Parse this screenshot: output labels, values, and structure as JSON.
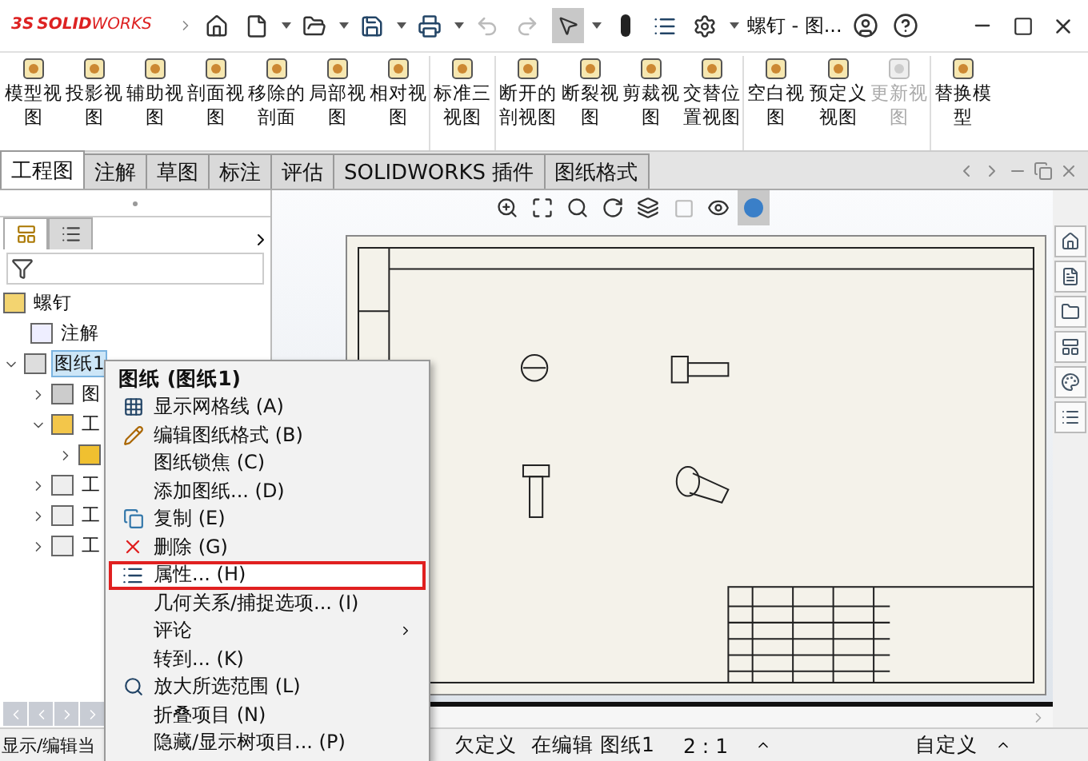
{
  "app": {
    "brand_prefix": "3S",
    "brand": "SOLID",
    "brand_suffix": "WORKS",
    "document_title": "螺钉 - 图..."
  },
  "ribbon": [
    {
      "label": "模型视图",
      "disabled": false,
      "separator_before": false
    },
    {
      "label": "投影视图",
      "disabled": false,
      "separator_before": false
    },
    {
      "label": "辅助视图",
      "disabled": false,
      "separator_before": false
    },
    {
      "label": "剖面视图",
      "disabled": false,
      "separator_before": false
    },
    {
      "label": "移除的剖面",
      "disabled": false,
      "separator_before": false
    },
    {
      "label": "局部视图",
      "disabled": false,
      "separator_before": false
    },
    {
      "label": "相对视图",
      "disabled": false,
      "separator_before": false
    },
    {
      "label": "标准三视图",
      "disabled": false,
      "separator_before": true
    },
    {
      "label": "断开的剖视图",
      "disabled": false,
      "separator_before": true
    },
    {
      "label": "断裂视图",
      "disabled": false,
      "separator_before": false
    },
    {
      "label": "剪裁视图",
      "disabled": false,
      "separator_before": false
    },
    {
      "label": "交替位置视图",
      "disabled": false,
      "separator_before": false
    },
    {
      "label": "空白视图",
      "disabled": false,
      "separator_before": true
    },
    {
      "label": "预定义视图",
      "disabled": false,
      "separator_before": false
    },
    {
      "label": "更新视图",
      "disabled": true,
      "separator_before": false
    },
    {
      "label": "替换模型",
      "disabled": false,
      "separator_before": true
    }
  ],
  "tabs": [
    {
      "label": "工程图",
      "selected": true
    },
    {
      "label": "注解",
      "selected": false
    },
    {
      "label": "草图",
      "selected": false
    },
    {
      "label": "标注",
      "selected": false
    },
    {
      "label": "评估",
      "selected": false
    },
    {
      "label": "SOLIDWORKS 插件",
      "selected": false
    },
    {
      "label": "图纸格式",
      "selected": false
    }
  ],
  "tree": {
    "label": "螺钉",
    "children": [
      {
        "label": "注解",
        "kind": "annotation",
        "selected": false
      },
      {
        "label": "图纸1",
        "kind": "sheet",
        "selected": true,
        "expanded": true,
        "children": [
          {
            "label": "图",
            "kind": "format",
            "selected": false,
            "expanded": false
          },
          {
            "label": "工",
            "kind": "view",
            "selected": false,
            "expanded": true,
            "children": [
              {
                "kind": "part",
                "expanded": false
              }
            ]
          },
          {
            "label": "工",
            "kind": "view2",
            "selected": false,
            "expanded": false
          },
          {
            "label": "工",
            "kind": "view2",
            "selected": false,
            "expanded": false
          },
          {
            "label": "工",
            "kind": "view2",
            "selected": false,
            "expanded": false
          }
        ]
      }
    ]
  },
  "context_menu": {
    "title": "图纸 (图纸1)",
    "items": [
      {
        "label": "显示网格线 (A)",
        "kind": "grid",
        "selected": false
      },
      {
        "label": "编辑图纸格式 (B)",
        "kind": "edit",
        "selected": false
      },
      {
        "label": "图纸锁焦 (C)",
        "kind": "plain",
        "selected": false
      },
      {
        "label": "添加图纸... (D)",
        "kind": "plain",
        "selected": false
      },
      {
        "label": "复制 (E)",
        "kind": "copy",
        "selected": false
      },
      {
        "label": "删除 (G)",
        "kind": "delete",
        "selected": false
      },
      {
        "label": "属性... (H)",
        "kind": "properties",
        "selected": true
      },
      {
        "label": "几何关系/捕捉选项... (I)",
        "kind": "plain",
        "selected": false
      },
      {
        "label": "评论",
        "kind": "submenu",
        "selected": false
      },
      {
        "label": "转到... (K)",
        "kind": "plain",
        "selected": false
      },
      {
        "label": "放大所选范围 (L)",
        "kind": "zoom",
        "selected": false
      },
      {
        "label": "折叠项目 (N)",
        "kind": "plain",
        "selected": false
      },
      {
        "label": "隐藏/显示树项目... (P)",
        "kind": "plain",
        "selected": false
      }
    ]
  },
  "status_bar": {
    "hint": "显示/编辑当",
    "state": "欠定义",
    "editing": "在编辑 图纸1",
    "scale": "2 : 1",
    "units": "自定义"
  }
}
